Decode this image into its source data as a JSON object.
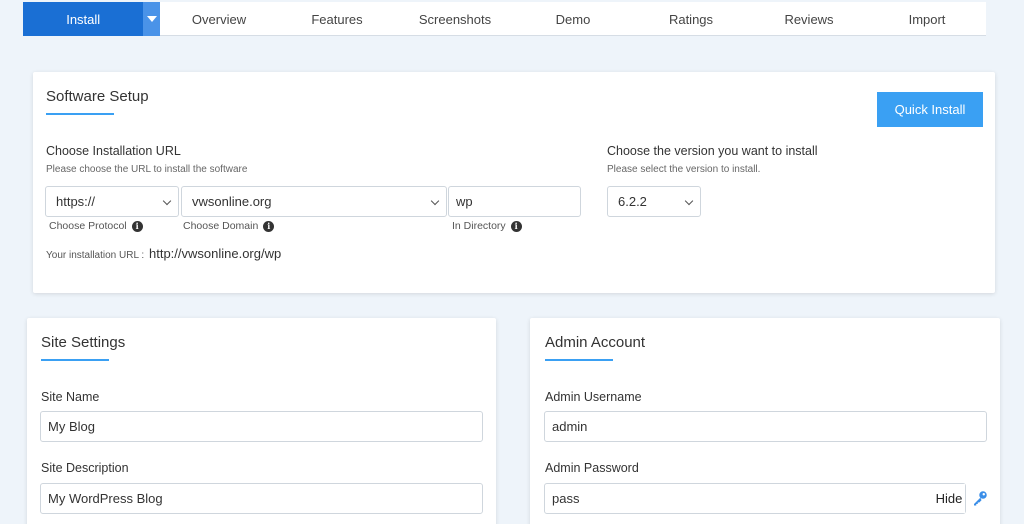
{
  "tabs": {
    "install": "Install",
    "items": [
      "Overview",
      "Features",
      "Screenshots",
      "Demo",
      "Ratings",
      "Reviews",
      "Import"
    ]
  },
  "software_setup": {
    "title": "Software Setup",
    "quick_install": "Quick Install",
    "url_label": "Choose Installation URL",
    "url_hint": "Please choose the URL to install the software",
    "protocol_value": "https://",
    "protocol_label": "Choose Protocol",
    "domain_value": "vwsonline.org",
    "domain_label": "Choose Domain",
    "directory_value": "wp",
    "directory_label": "In Directory",
    "install_url_label": "Your installation URL :",
    "install_url_value": "http://vwsonline.org/wp",
    "version_label": "Choose the version you want to install",
    "version_hint": "Please select the version to install.",
    "version_value": "6.2.2"
  },
  "site_settings": {
    "title": "Site Settings",
    "site_name_label": "Site Name",
    "site_name_value": "My Blog",
    "site_desc_label": "Site Description",
    "site_desc_value": "My WordPress Blog"
  },
  "admin_account": {
    "title": "Admin Account",
    "username_label": "Admin Username",
    "username_value": "admin",
    "password_label": "Admin Password",
    "password_value": "pass",
    "hide_label": "Hide"
  },
  "colors": {
    "primary": "#1a6fd4",
    "accent": "#3aa0f3",
    "background": "#eef4fa"
  }
}
